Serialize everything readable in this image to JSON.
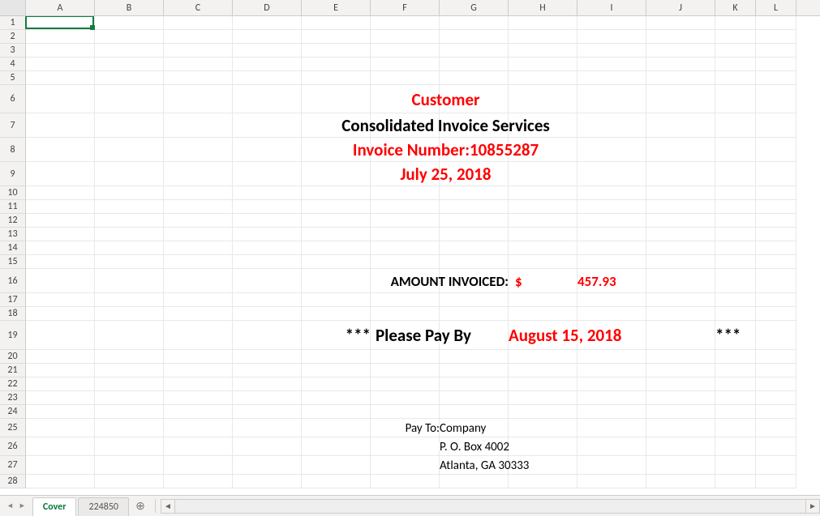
{
  "columns": [
    {
      "label": "A",
      "w": 85
    },
    {
      "label": "B",
      "w": 85
    },
    {
      "label": "C",
      "w": 85
    },
    {
      "label": "D",
      "w": 85
    },
    {
      "label": "E",
      "w": 85
    },
    {
      "label": "F",
      "w": 85
    },
    {
      "label": "G",
      "w": 85
    },
    {
      "label": "H",
      "w": 85
    },
    {
      "label": "I",
      "w": 85
    },
    {
      "label": "J",
      "w": 85
    },
    {
      "label": "K",
      "w": 50
    },
    {
      "label": "L",
      "w": 50
    }
  ],
  "row_heights": {
    "default": 17,
    "6": 35,
    "7": 30,
    "8": 30,
    "9": 30,
    "16": 30,
    "19": 36,
    "25": 23,
    "26": 23,
    "27": 23
  },
  "header": {
    "customer": "Customer",
    "company_line": "Consolidated Invoice Services",
    "invoice_number_label": "Invoice Number:",
    "invoice_number": "10855287",
    "invoice_date": "July 25, 2018"
  },
  "amount": {
    "label": "AMOUNT INVOICED:",
    "currency": "$",
    "value": "457.93"
  },
  "pay_by": {
    "stars_left": "***",
    "label": "Please Pay By",
    "date": "August 15, 2018",
    "stars_right": "***"
  },
  "pay_to": {
    "label": "Pay To:",
    "line1": "Company",
    "line2": "P. O. Box 4002",
    "line3": "Atlanta, GA  30333"
  },
  "tabs": {
    "active": "Cover",
    "other": "224850"
  }
}
